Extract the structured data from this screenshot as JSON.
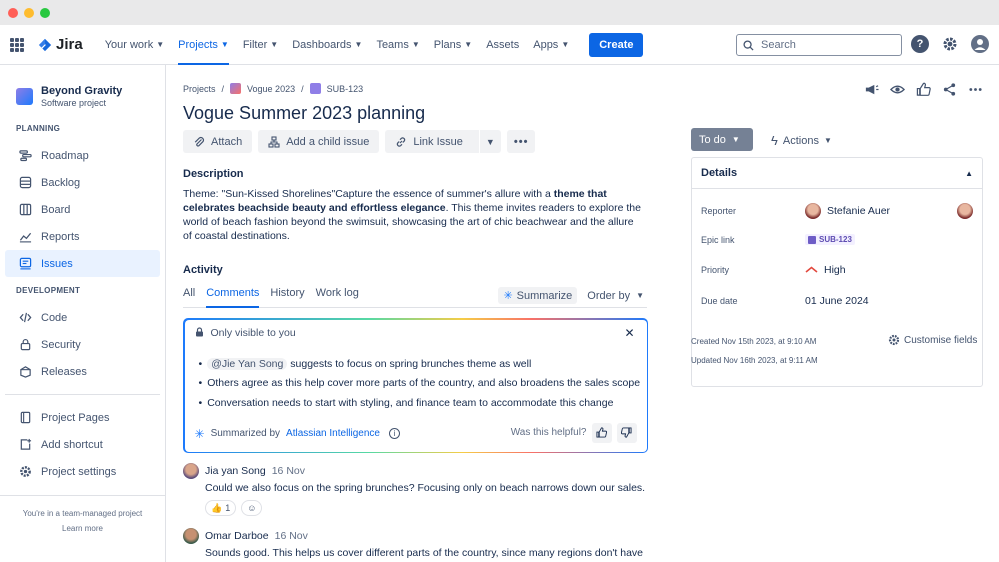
{
  "topnav": {
    "logo_text": "Jira",
    "items": [
      {
        "label": "Your work"
      },
      {
        "label": "Projects"
      },
      {
        "label": "Filter"
      },
      {
        "label": "Dashboards"
      },
      {
        "label": "Teams"
      },
      {
        "label": "Plans"
      },
      {
        "label": "Assets"
      },
      {
        "label": "Apps"
      }
    ],
    "create_label": "Create",
    "search_placeholder": "Search",
    "help_glyph": "?"
  },
  "sidebar": {
    "project_name": "Beyond Gravity",
    "project_type": "Software project",
    "planning_title": "PLANNING",
    "planning_items": [
      {
        "label": "Roadmap",
        "icon": "roadmap-icon"
      },
      {
        "label": "Backlog",
        "icon": "backlog-icon"
      },
      {
        "label": "Board",
        "icon": "board-icon"
      },
      {
        "label": "Reports",
        "icon": "reports-icon"
      },
      {
        "label": "Issues",
        "icon": "issues-icon"
      }
    ],
    "development_title": "DEVELOPMENT",
    "development_items": [
      {
        "label": "Code",
        "icon": "code-icon"
      },
      {
        "label": "Security",
        "icon": "security-icon"
      },
      {
        "label": "Releases",
        "icon": "releases-icon"
      }
    ],
    "other_items": [
      {
        "label": "Project Pages",
        "icon": "pages-icon"
      },
      {
        "label": "Add shortcut",
        "icon": "add-shortcut-icon"
      },
      {
        "label": "Project settings",
        "icon": "settings-icon"
      }
    ],
    "footer_text": "You're in a team-managed project",
    "footer_link": "Learn more"
  },
  "breadcrumb": {
    "projects": "Projects",
    "separator": "/",
    "project": "Vogue 2023",
    "issue": "SUB-123"
  },
  "issue": {
    "title": "Vogue Summer 2023 planning",
    "buttons": {
      "attach": "Attach",
      "add_child": "Add a child issue",
      "link_issue": "Link Issue"
    },
    "description_heading": "Description",
    "description": {
      "part1": "Theme:  \"Sun-Kissed Shorelines\"Capture the essence of summer's allure with a ",
      "bold": "theme that celebrates beachside beauty and effortless elegance",
      "part2": ". This theme invites readers to explore the world of beach fashion beyond the swimsuit, showcasing the art of chic beachwear and the allure of coastal destinations."
    }
  },
  "activity": {
    "heading": "Activity",
    "tabs": [
      "All",
      "Comments",
      "History",
      "Work log"
    ],
    "summarize_label": "Summarize",
    "order_label": "Order by",
    "ai_summary": {
      "visibility": "Only visible to you",
      "bullet1_mention": "@Jie Yan Song",
      "bullet1_rest": " suggests to focus on spring brunches theme as well",
      "bullet2": "Others agree as this help cover more parts of the country, and also broadens the sales scope",
      "bullet3": "Conversation needs to start with styling, and finance team to accommodate this change",
      "footer_prefix": "Summarized by",
      "footer_link": "Atlassian Intelligence",
      "helpful_question": "Was this helpful?"
    },
    "comments": [
      {
        "author": "Jia yan Song",
        "date": "16 Nov",
        "body": "Could we also focus on the spring brunches? Focusing only on beach narrows down our sales.",
        "reaction_count": "1"
      },
      {
        "author": "Omar Darboe",
        "date": "16 Nov",
        "body": "Sounds good. This helps us cover different parts of the country, since many regions don't have"
      }
    ]
  },
  "details_panel": {
    "status": "To do",
    "actions_label": "Actions",
    "heading": "Details",
    "reporter_label": "Reporter",
    "reporter": "Stefanie Auer",
    "epic_label": "Epic link",
    "epic": "SUB-123",
    "priority_label": "Priority",
    "priority": "High",
    "due_label": "Due date",
    "due": "01 June 2024",
    "created": "Created Nov 15th 2023, at 9:10 AM",
    "updated": "Updated Nov 16th 2023, at 9:11 AM",
    "customise": "Customise fields"
  },
  "colors": {
    "accent": "#0c66e4",
    "status_todo": "#758195",
    "priority_high": "#e2483d",
    "epic_purple": "#6e5dc6"
  }
}
